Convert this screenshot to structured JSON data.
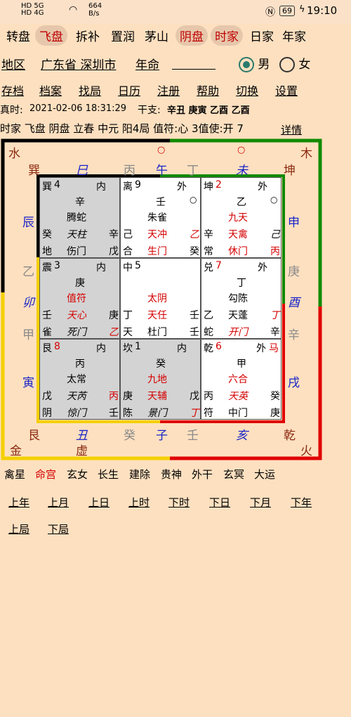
{
  "status": {
    "sim1": "HD 5G",
    "sim2": "HD 4G",
    "speed_value": "664",
    "speed_unit": "B/s",
    "battery": "69",
    "time": "19:10"
  },
  "topnav": [
    "转盘",
    "飞盘",
    "拆补",
    "置润",
    "茅山",
    "阴盘",
    "时家",
    "日家",
    "年家"
  ],
  "row2": {
    "region_label": "地区",
    "region_value": "广东省 深圳市",
    "fate_label": "年命",
    "fate_value": "",
    "male": "男",
    "female": "女"
  },
  "menu": [
    "存档",
    "档案",
    "找局",
    "日历",
    "注册",
    "帮助",
    "切换",
    "设置"
  ],
  "info": {
    "true_time_label": "真时:",
    "true_time": "2021-02-06 18:31:29",
    "ganzhi_label": "干支:",
    "ganzhi": "辛丑 庚寅 乙酉 乙酉",
    "line5": "时家 飞盘 阴盘 立春 中元 阳4局 值符:心 3值使:开 7",
    "detail": "详情"
  },
  "outer": {
    "shui": "水",
    "mu": "木",
    "jin": "金",
    "huo": "火",
    "xun": "巽",
    "si": "巳",
    "bing_top": "丙",
    "wu": "午",
    "ding_top": "丁",
    "wei": "未",
    "kun": "坤",
    "circle1": "○",
    "circle2": "○",
    "chen": "辰",
    "shen": "申",
    "yi_left": "乙",
    "geng_right": "庚",
    "mao": "卯",
    "you": "酉",
    "jia_left": "甲",
    "xin_right": "辛",
    "yin": "寅",
    "xu": "戌",
    "gen": "艮",
    "chou": "丑",
    "gui_bottom": "癸",
    "zi": "子",
    "ren_bottom": "壬",
    "hai": "亥",
    "qian": "乾",
    "xu_void": "虚"
  },
  "cells": {
    "xun": {
      "name": "巽",
      "num": "4",
      "pos": "内",
      "stem": "辛",
      "god": "腾蛇",
      "l1": "癸",
      "star": "天柱",
      "r1": "辛",
      "l2": "地",
      "door": "伤门",
      "r2": "戊"
    },
    "li": {
      "name": "离",
      "num": "9",
      "pos": "外",
      "stem": "壬",
      "god": "朱雀",
      "l1": "己",
      "star": "天冲",
      "r1": "乙",
      "l2": "合",
      "door": "生门",
      "r2": "癸",
      "mark": "○"
    },
    "kun": {
      "name": "坤",
      "num": "2",
      "pos": "外",
      "stem": "乙",
      "god": "九天",
      "l1": "辛",
      "star": "天禽",
      "r1": "己",
      "l2": "常",
      "door": "休门",
      "r2": "丙",
      "mark": "○"
    },
    "zhen": {
      "name": "震",
      "num": "3",
      "pos": "内",
      "stem": "庚",
      "god": "值符",
      "l1": "壬",
      "star": "天心",
      "r1": "庚",
      "l2": "雀",
      "door": "死门",
      "r2": "乙"
    },
    "zhong": {
      "name": "中",
      "num": "5",
      "god": "太阴",
      "l1": "丁",
      "star": "天任",
      "r1": "壬",
      "l2": "天",
      "door": "杜门",
      "r2": "壬"
    },
    "dui": {
      "name": "兑",
      "num": "7",
      "pos": "外",
      "stem": "丁",
      "god": "勾陈",
      "l1": "乙",
      "star": "天蓬",
      "r1": "丁",
      "l2": "蛇",
      "door": "开门",
      "r2": "辛"
    },
    "gen": {
      "name": "艮",
      "num": "8",
      "pos": "内",
      "stem": "丙",
      "god": "太常",
      "l1": "戊",
      "star": "天芮",
      "r1": "丙",
      "l2": "阴",
      "door": "惊门",
      "r2": "壬"
    },
    "kan": {
      "name": "坎",
      "num": "1",
      "pos": "内",
      "stem": "癸",
      "god": "九地",
      "l1": "庚",
      "star": "天辅",
      "r1": "戊",
      "l2": "陈",
      "door": "景门",
      "r2": "丁"
    },
    "qian": {
      "name": "乾",
      "num": "6",
      "pos": "外",
      "horse": "马",
      "stem": "甲",
      "god": "六合",
      "l1": "丙",
      "star": "天英",
      "r1": "癸",
      "l2": "符",
      "door": "中门",
      "r2": "庚"
    }
  },
  "bottom_tabs": [
    "禽星",
    "命宫",
    "玄女",
    "长生",
    "建除",
    "贵神",
    "外干",
    "玄冥",
    "大运"
  ],
  "nav1": [
    "上年",
    "上月",
    "上日",
    "上时",
    "下时",
    "下日",
    "下月",
    "下年"
  ],
  "nav2": [
    "上局",
    "下局"
  ],
  "colors": {
    "red": "#d40000",
    "blue": "#1a24c9",
    "bg": "#fde0c0",
    "shade": "#d3d3d3"
  }
}
